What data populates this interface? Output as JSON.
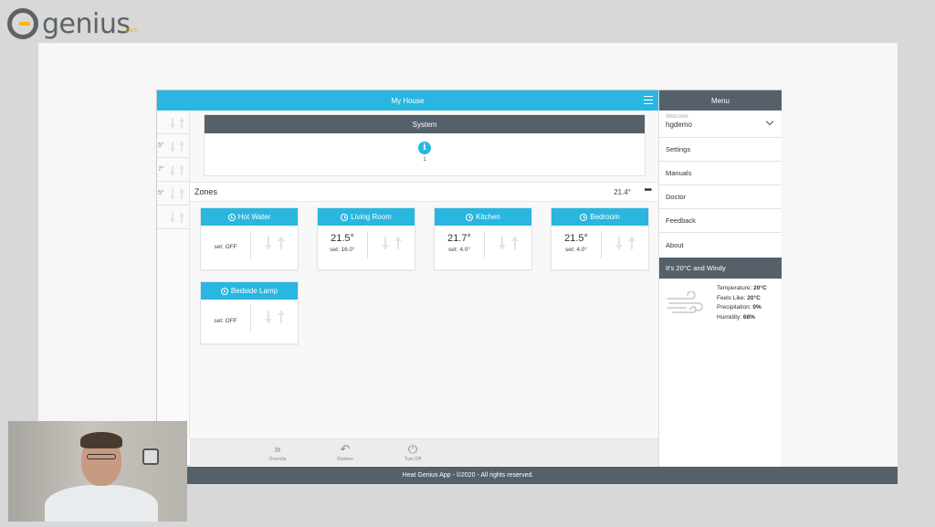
{
  "brand": {
    "name": "genius",
    "suffix": ".com"
  },
  "app": {
    "title": "My House",
    "footer": "Heat Genius App - ©2020 - All rights reserved."
  },
  "left_strip": [
    "",
    "5°",
    "7°",
    "5°",
    ""
  ],
  "system": {
    "title": "System",
    "count": "1"
  },
  "zones": {
    "title": "Zones",
    "temperature": "21.4°",
    "more": "•••",
    "items": [
      {
        "name": "Hot Water",
        "temp": "",
        "set": "set: OFF"
      },
      {
        "name": "Living Room",
        "temp": "21.5°",
        "set": "set: 16.0°"
      },
      {
        "name": "Kitchen",
        "temp": "21.7°",
        "set": "set: 4.0°"
      },
      {
        "name": "Bedroom",
        "temp": "21.5°",
        "set": "set: 4.0°"
      },
      {
        "name": "Bedside Lamp",
        "temp": "",
        "set": "set: OFF"
      }
    ]
  },
  "toolbar": {
    "override": "Override",
    "restore": "Restore",
    "turn_off": "Turn Off"
  },
  "menu": {
    "title": "Menu",
    "welcome_label": "Welcome",
    "user": "hgdemo",
    "items": [
      "Settings",
      "Manuals",
      "Doctor",
      "Feedback",
      "About"
    ]
  },
  "weather": {
    "headline": "It's 20°C and Windy",
    "temperature_label": "Temperature:",
    "temperature": "20°C",
    "feels_like_label": "Feels Like:",
    "feels_like": "20°C",
    "precipitation_label": "Precipitation:",
    "precipitation": "0%",
    "humidity_label": "Humidity:",
    "humidity": "68%"
  },
  "colors": {
    "accent": "#29b6e0",
    "dark": "#55606a",
    "brand_gray": "#5d6366",
    "brand_yellow": "#f3b711"
  }
}
